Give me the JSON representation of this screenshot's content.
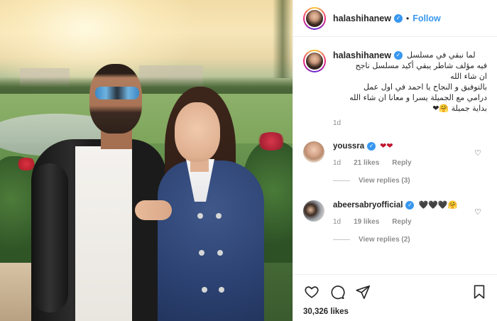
{
  "post": {
    "username": "halashihanew",
    "follow_label": "Follow",
    "separator": "•",
    "caption": [
      "لما نبقي في مسلسل",
      "فيه مؤلف شاطر يبقي أكيد مسلسل ناجح",
      "ان شاء الله",
      "بالتوفيق و النجاح يا احمد في اول عمل",
      "درامي مع الجميلة يسرا و معانا ان شاء الله",
      "بداية جميلة 🤗❤"
    ],
    "time": "1d",
    "likes": "30,326 likes"
  },
  "comments": [
    {
      "username": "youssra",
      "text": "❤❤",
      "time": "1d",
      "likes": "21 likes",
      "reply_label": "Reply",
      "view_replies": "View replies (3)"
    },
    {
      "username": "abeersabryofficial",
      "text": "🖤🖤🖤🤗",
      "time": "1d",
      "likes": "19 likes",
      "reply_label": "Reply",
      "view_replies": "View replies (2)"
    }
  ],
  "icons": {
    "verified": "verified-badge-icon",
    "heart": "heart-icon",
    "comment": "comment-icon",
    "share": "share-icon",
    "bookmark": "bookmark-icon"
  },
  "colors": {
    "link_blue": "#3897f0",
    "text": "#262626",
    "muted": "#8e8e8e",
    "divider": "#efefef"
  }
}
